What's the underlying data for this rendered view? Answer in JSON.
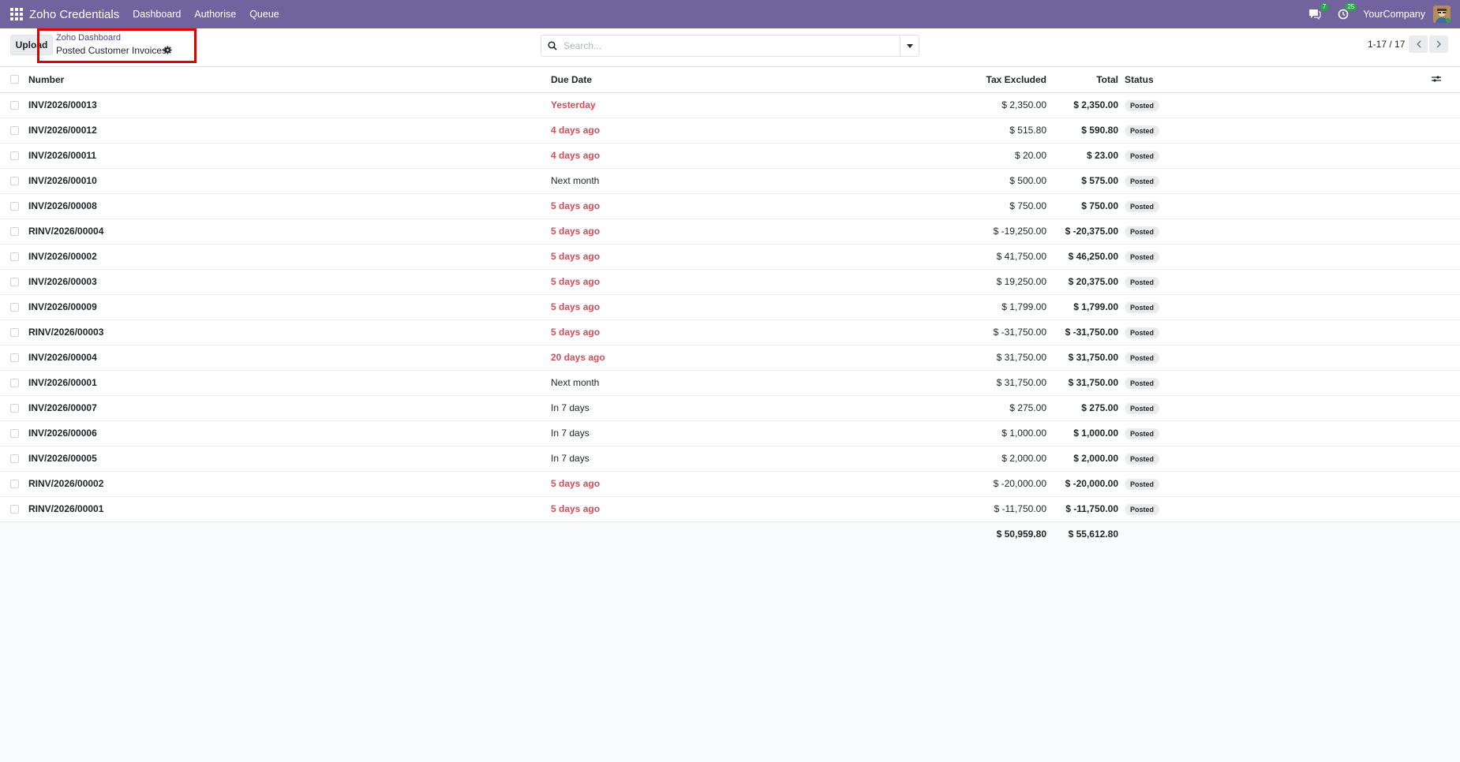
{
  "navbar": {
    "app_title": "Zoho Credentials",
    "menu": [
      "Dashboard",
      "Authorise",
      "Queue"
    ],
    "messages_badge": "7",
    "activities_badge": "25",
    "company": "YourCompany",
    "color": "#71639e"
  },
  "control": {
    "upload_label": "Upload",
    "breadcrumb_parent": "Zoho Dashboard",
    "page_title": "Posted Customer Invoices",
    "search_placeholder": "Search...",
    "pager": "1-17 / 17"
  },
  "table": {
    "headers": {
      "number": "Number",
      "due_date": "Due Date",
      "tax_excluded": "Tax Excluded",
      "total": "Total",
      "status": "Status"
    },
    "rows": [
      {
        "number": "INV/2026/00013",
        "due": "Yesterday",
        "overdue": true,
        "tax_excluded": "$ 2,350.00",
        "total": "$ 2,350.00",
        "status": "Posted"
      },
      {
        "number": "INV/2026/00012",
        "due": "4 days ago",
        "overdue": true,
        "tax_excluded": "$ 515.80",
        "total": "$ 590.80",
        "status": "Posted"
      },
      {
        "number": "INV/2026/00011",
        "due": "4 days ago",
        "overdue": true,
        "tax_excluded": "$ 20.00",
        "total": "$ 23.00",
        "status": "Posted"
      },
      {
        "number": "INV/2026/00010",
        "due": "Next month",
        "overdue": false,
        "tax_excluded": "$ 500.00",
        "total": "$ 575.00",
        "status": "Posted"
      },
      {
        "number": "INV/2026/00008",
        "due": "5 days ago",
        "overdue": true,
        "tax_excluded": "$ 750.00",
        "total": "$ 750.00",
        "status": "Posted"
      },
      {
        "number": "RINV/2026/00004",
        "due": "5 days ago",
        "overdue": true,
        "tax_excluded": "$ -19,250.00",
        "total": "$ -20,375.00",
        "status": "Posted"
      },
      {
        "number": "INV/2026/00002",
        "due": "5 days ago",
        "overdue": true,
        "tax_excluded": "$ 41,750.00",
        "total": "$ 46,250.00",
        "status": "Posted"
      },
      {
        "number": "INV/2026/00003",
        "due": "5 days ago",
        "overdue": true,
        "tax_excluded": "$ 19,250.00",
        "total": "$ 20,375.00",
        "status": "Posted"
      },
      {
        "number": "INV/2026/00009",
        "due": "5 days ago",
        "overdue": true,
        "tax_excluded": "$ 1,799.00",
        "total": "$ 1,799.00",
        "status": "Posted"
      },
      {
        "number": "RINV/2026/00003",
        "due": "5 days ago",
        "overdue": true,
        "tax_excluded": "$ -31,750.00",
        "total": "$ -31,750.00",
        "status": "Posted"
      },
      {
        "number": "INV/2026/00004",
        "due": "20 days ago",
        "overdue": true,
        "tax_excluded": "$ 31,750.00",
        "total": "$ 31,750.00",
        "status": "Posted"
      },
      {
        "number": "INV/2026/00001",
        "due": "Next month",
        "overdue": false,
        "tax_excluded": "$ 31,750.00",
        "total": "$ 31,750.00",
        "status": "Posted"
      },
      {
        "number": "INV/2026/00007",
        "due": "In 7 days",
        "overdue": false,
        "tax_excluded": "$ 275.00",
        "total": "$ 275.00",
        "status": "Posted"
      },
      {
        "number": "INV/2026/00006",
        "due": "In 7 days",
        "overdue": false,
        "tax_excluded": "$ 1,000.00",
        "total": "$ 1,000.00",
        "status": "Posted"
      },
      {
        "number": "INV/2026/00005",
        "due": "In 7 days",
        "overdue": false,
        "tax_excluded": "$ 2,000.00",
        "total": "$ 2,000.00",
        "status": "Posted"
      },
      {
        "number": "RINV/2026/00002",
        "due": "5 days ago",
        "overdue": true,
        "tax_excluded": "$ -20,000.00",
        "total": "$ -20,000.00",
        "status": "Posted"
      },
      {
        "number": "RINV/2026/00001",
        "due": "5 days ago",
        "overdue": true,
        "tax_excluded": "$ -11,750.00",
        "total": "$ -11,750.00",
        "status": "Posted"
      }
    ],
    "totals": {
      "tax_excluded": "$ 50,959.80",
      "total": "$ 55,612.80"
    }
  },
  "colors": {
    "overdue": "#d44c59",
    "highlight": "#e00000",
    "link": "#4b3ea0"
  }
}
